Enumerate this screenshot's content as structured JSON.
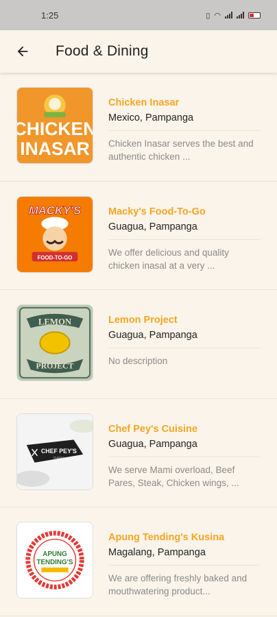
{
  "status": {
    "time": "1:25",
    "battery_label": "18"
  },
  "header": {
    "back_icon": "arrow-left-icon",
    "title": "Food & Dining"
  },
  "restaurants": [
    {
      "name": "Chicken Inasar",
      "location": "Mexico, Pampanga",
      "description": "Chicken Inasar serves the best and authentic chicken ...",
      "logo_text": [
        "CHICKEN",
        "INASAR"
      ],
      "brand_color": "#f0962a"
    },
    {
      "name": "Macky's Food-To-Go",
      "location": "Guagua, Pampanga",
      "description": "We offer delicious and quality chicken inasal at a very ...",
      "logo_text": [
        "MACKY'S",
        "FOOD-TO-GO"
      ],
      "brand_color": "#f57c00"
    },
    {
      "name": "Lemon Project",
      "location": "Guagua, Pampanga",
      "description": "No description",
      "logo_text": [
        "LEMON",
        "PROJECT"
      ],
      "brand_color": "#6e8f7a"
    },
    {
      "name": "Chef Pey's Cuisine",
      "location": "Guagua, Pampanga",
      "description": "We serve Mami overload, Beef Pares, Steak, Chicken wings, ...",
      "logo_text": [
        "CHEF PEY'S",
        "Cuisine"
      ],
      "brand_color": "#222222"
    },
    {
      "name": "Apung Tending's Kusina",
      "location": "Magalang, Pampanga",
      "description": "We are offering freshly baked and mouthwatering product...",
      "logo_text": [
        "APUNG",
        "TENDING'S"
      ],
      "brand_color": "#e53935"
    }
  ]
}
